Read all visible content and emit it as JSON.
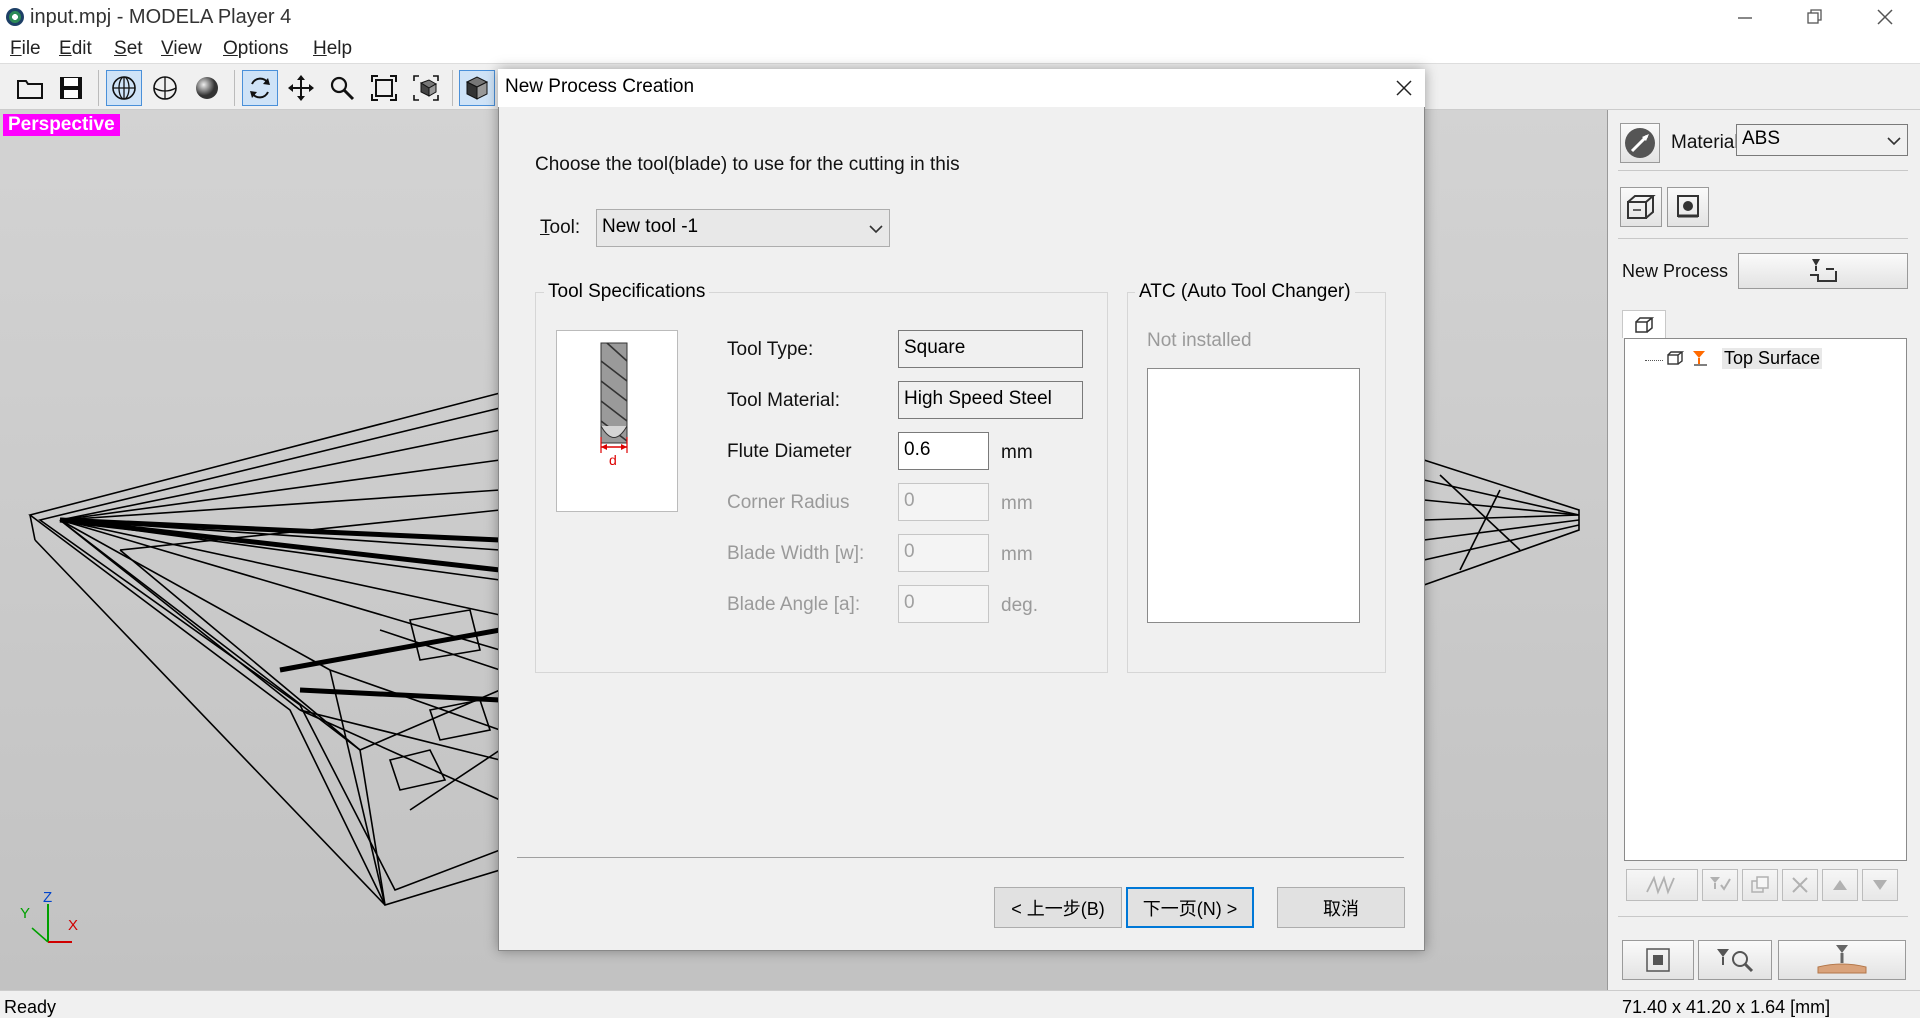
{
  "window": {
    "title": "input.mpj - MODELA Player 4"
  },
  "menu": [
    {
      "key": "F",
      "rest": "ile"
    },
    {
      "key": "E",
      "rest": "dit"
    },
    {
      "key": "S",
      "rest": "et"
    },
    {
      "key": "V",
      "rest": "iew"
    },
    {
      "key": "O",
      "rest": "ptions"
    },
    {
      "key": "H",
      "rest": "elp"
    }
  ],
  "viewport": {
    "label": "Perspective",
    "axes": {
      "x": "X",
      "y": "Y",
      "z": "Z"
    },
    "colors": {
      "label_bg": "#ff00ff"
    }
  },
  "right_panel": {
    "material_label": "Material",
    "material_value": "ABS",
    "new_process_label": "New Process",
    "tree_item": "Top Surface"
  },
  "status": {
    "text": "Ready",
    "dimensions": "71.40 x 41.20 x 1.64 [mm]"
  },
  "dialog": {
    "title": "New Process Creation",
    "instruction": "Choose the tool(blade) to use for the cutting in this",
    "tool_label_key": "T",
    "tool_label_rest": "ool:",
    "tool_value": "New tool -1",
    "specs_group_title": "Tool Specifications",
    "tool_type_label": "Tool Type:",
    "tool_type_value": "Square",
    "tool_material_label": "Tool Material:",
    "tool_material_value": "High Speed Steel",
    "flute_diameter_label": "Flute Diameter",
    "flute_diameter_value": "0.6",
    "flute_diameter_unit": "mm",
    "corner_radius_label": "Corner Radius",
    "corner_radius_value": "0",
    "corner_radius_unit": "mm",
    "blade_width_label": "Blade Width [w]:",
    "blade_width_value": "0",
    "blade_width_unit": "mm",
    "blade_angle_label": "Blade Angle [a]:",
    "blade_angle_value": "0",
    "blade_angle_unit": "deg.",
    "tool_image_dim": "d",
    "atc_group_title": "ATC (Auto Tool Changer)",
    "atc_status": "Not installed",
    "back_button": "< 上一步(B)",
    "next_button": "下一页(N) >",
    "cancel_button": "取消"
  }
}
